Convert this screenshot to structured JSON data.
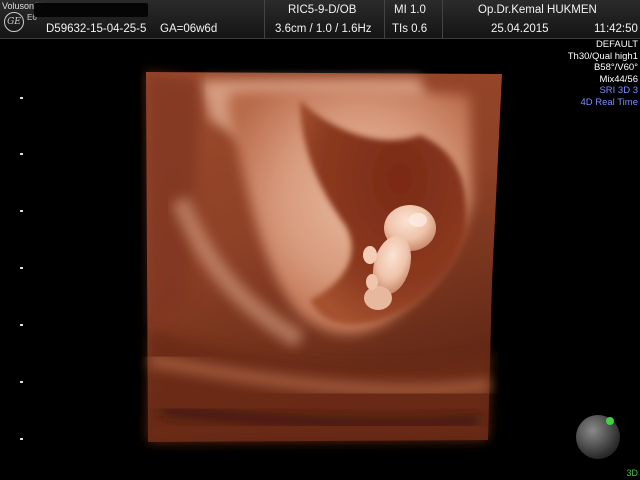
{
  "header": {
    "brand": "Voluson™",
    "logo": "GE",
    "model": "E6",
    "patient_id": "D59632-15-04-25-5",
    "gestational_age": "GA=06w6d",
    "probe": "RIC5-9-D/OB",
    "mi": "MI  1.0",
    "depth_settings": "3.6cm / 1.0 / 1.6Hz",
    "tis": "TIs  0.6",
    "doctor": "Op.Dr.Kemal HUKMEN",
    "date": "25.04.2015",
    "time": "11:42:50"
  },
  "settings_panel": {
    "lines": [
      "DEFAULT",
      "Th30/Qual high1",
      "B58°/V60°",
      "Mix44/56"
    ],
    "highlighted_lines": [
      "SRI 3D 3",
      "4D Real Time"
    ]
  },
  "footer": {
    "mode_label": "3D"
  },
  "colors": {
    "tissue_dark": "#8a3d22",
    "tissue_light": "#e9b49a",
    "background": "#000000",
    "highlight_text": "#7f8cff",
    "indicator": "#3fd43f"
  },
  "icons": [
    "ge-logo",
    "orientation-ball-icon"
  ]
}
